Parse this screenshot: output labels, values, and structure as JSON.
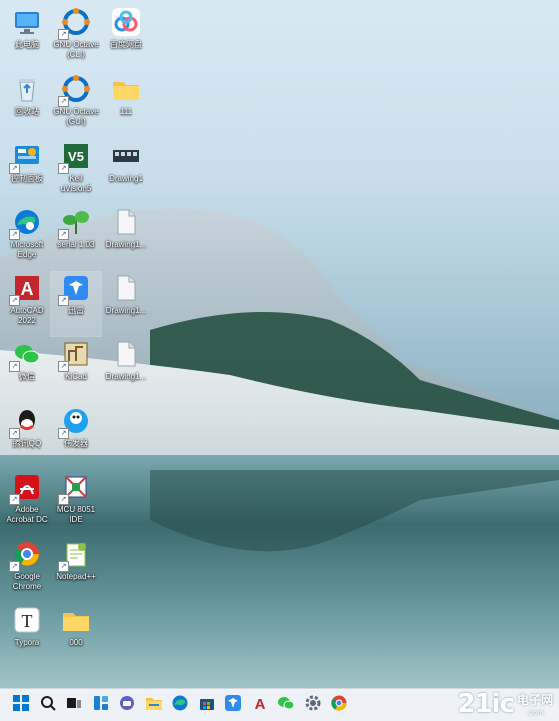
{
  "desktop_icons": [
    {
      "label": "此电脑",
      "icon": "pc-icon"
    },
    {
      "label": "GNU Octave\n(CLI)",
      "icon": "octave-icon"
    },
    {
      "label": "百度网盘",
      "icon": "baidu-netdisk-icon"
    },
    {
      "label": "回收站",
      "icon": "recycle-bin-icon"
    },
    {
      "label": "GNU Octave\n(GUI)",
      "icon": "octave-icon"
    },
    {
      "label": "111",
      "icon": "folder-icon"
    },
    {
      "label": "控制面板",
      "icon": "control-panel-icon"
    },
    {
      "label": "Keil\nuVision5",
      "icon": "keil-icon"
    },
    {
      "label": "Drawing1",
      "icon": "drawing-icon"
    },
    {
      "label": "Microsoft\nEdge",
      "icon": "edge-icon"
    },
    {
      "label": "serial 1.03",
      "icon": "serial-icon"
    },
    {
      "label": "Drawing1...",
      "icon": "file-icon"
    },
    {
      "label": "AutoCAD\n2022",
      "icon": "autocad-icon"
    },
    {
      "label": "迅雷",
      "icon": "xunlei-icon"
    },
    {
      "label": "Drawing1...",
      "icon": "file-icon"
    },
    {
      "label": "微信",
      "icon": "wechat-icon"
    },
    {
      "label": "KiCad",
      "icon": "kicad-icon"
    },
    {
      "label": "Drawing1...",
      "icon": "file-icon"
    },
    {
      "label": "腾讯QQ",
      "icon": "qq-icon"
    },
    {
      "label": "伟发器",
      "icon": "compass-icon"
    },
    {
      "label": "Adobe\nAcrobat DC",
      "icon": "acrobat-icon"
    },
    {
      "label": "MCU 8051\nIDE",
      "icon": "mcu8051-icon"
    },
    {
      "label": "Google\nChrome",
      "icon": "chrome-icon"
    },
    {
      "label": "Notepad++",
      "icon": "notepadpp-icon"
    },
    {
      "label": "Typora",
      "icon": "typora-icon"
    },
    {
      "label": "000",
      "icon": "folder-icon"
    }
  ],
  "taskbar": {
    "items": [
      "start-icon",
      "search-icon",
      "task-view-icon",
      "widgets-icon",
      "chat-icon",
      "file-explorer-icon",
      "edge-icon",
      "store-icon",
      "xunlei-icon",
      "autocad-icon",
      "wechat-icon",
      "settings-icon",
      "chrome-icon"
    ]
  },
  "watermark": {
    "number": "21ic",
    "cn": "电子网",
    "en": ".com"
  },
  "colors": {
    "taskbar_bg": "#eef2f6",
    "accent": "#0078d4"
  }
}
